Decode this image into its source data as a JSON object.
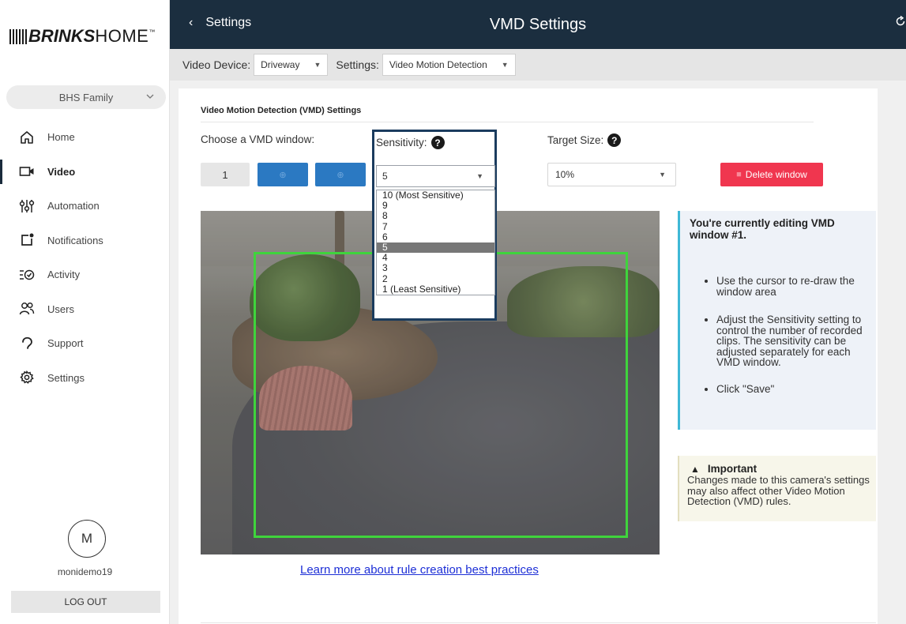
{
  "brand": {
    "logo_bold": "BRINKS",
    "logo_light": "HOME",
    "logo_tm": "™"
  },
  "account": {
    "name": "BHS Family"
  },
  "nav": [
    {
      "label": "Home",
      "icon": "home-icon"
    },
    {
      "label": "Video",
      "icon": "video-camera-icon",
      "active": true
    },
    {
      "label": "Automation",
      "icon": "sliders-icon"
    },
    {
      "label": "Notifications",
      "icon": "notification-icon"
    },
    {
      "label": "Activity",
      "icon": "activity-icon"
    },
    {
      "label": "Users",
      "icon": "users-icon"
    },
    {
      "label": "Support",
      "icon": "support-icon"
    },
    {
      "label": "Settings",
      "icon": "gear-icon"
    }
  ],
  "user": {
    "initial": "M",
    "username": "monidemo19",
    "logout_label": "LOG OUT"
  },
  "topbar": {
    "back_label": "Settings",
    "title": "VMD Settings"
  },
  "filters": {
    "device_label": "Video Device:",
    "device_value": "Driveway",
    "settings_label": "Settings:",
    "settings_value": "Video Motion Detection"
  },
  "card": {
    "title": "Video Motion Detection (VMD) Settings",
    "choose_window_label": "Choose a VMD window:",
    "window_buttons": [
      "1"
    ],
    "sensitivity_label": "Sensitivity:",
    "sensitivity_value": "5",
    "target_size_label": "Target Size:",
    "target_size_value": "10%",
    "delete_label": "Delete window",
    "learn_more": "Learn more about rule creation best practices"
  },
  "sensitivity_options": [
    "10 (Most Sensitive)",
    "9",
    "8",
    "7",
    "6",
    "5",
    "4",
    "3",
    "2",
    "1 (Least Sensitive)"
  ],
  "info": {
    "title": "You're currently editing VMD window #1.",
    "bullets": [
      "Use the cursor to re-draw the window area",
      "Adjust the Sensitivity setting to control the number of recorded clips. The sensitivity can be adjusted separately for each VMD window.",
      "Click \"Save\""
    ]
  },
  "important": {
    "heading": "Important",
    "body": "Changes made to this camera's settings may also affect other Video Motion Detection (VMD) rules."
  },
  "colors": {
    "topbar": "#1b2e3f",
    "accent_blue": "#2b79c2",
    "delete_red": "#f0364f",
    "vmd_window": "#3fd43c"
  }
}
